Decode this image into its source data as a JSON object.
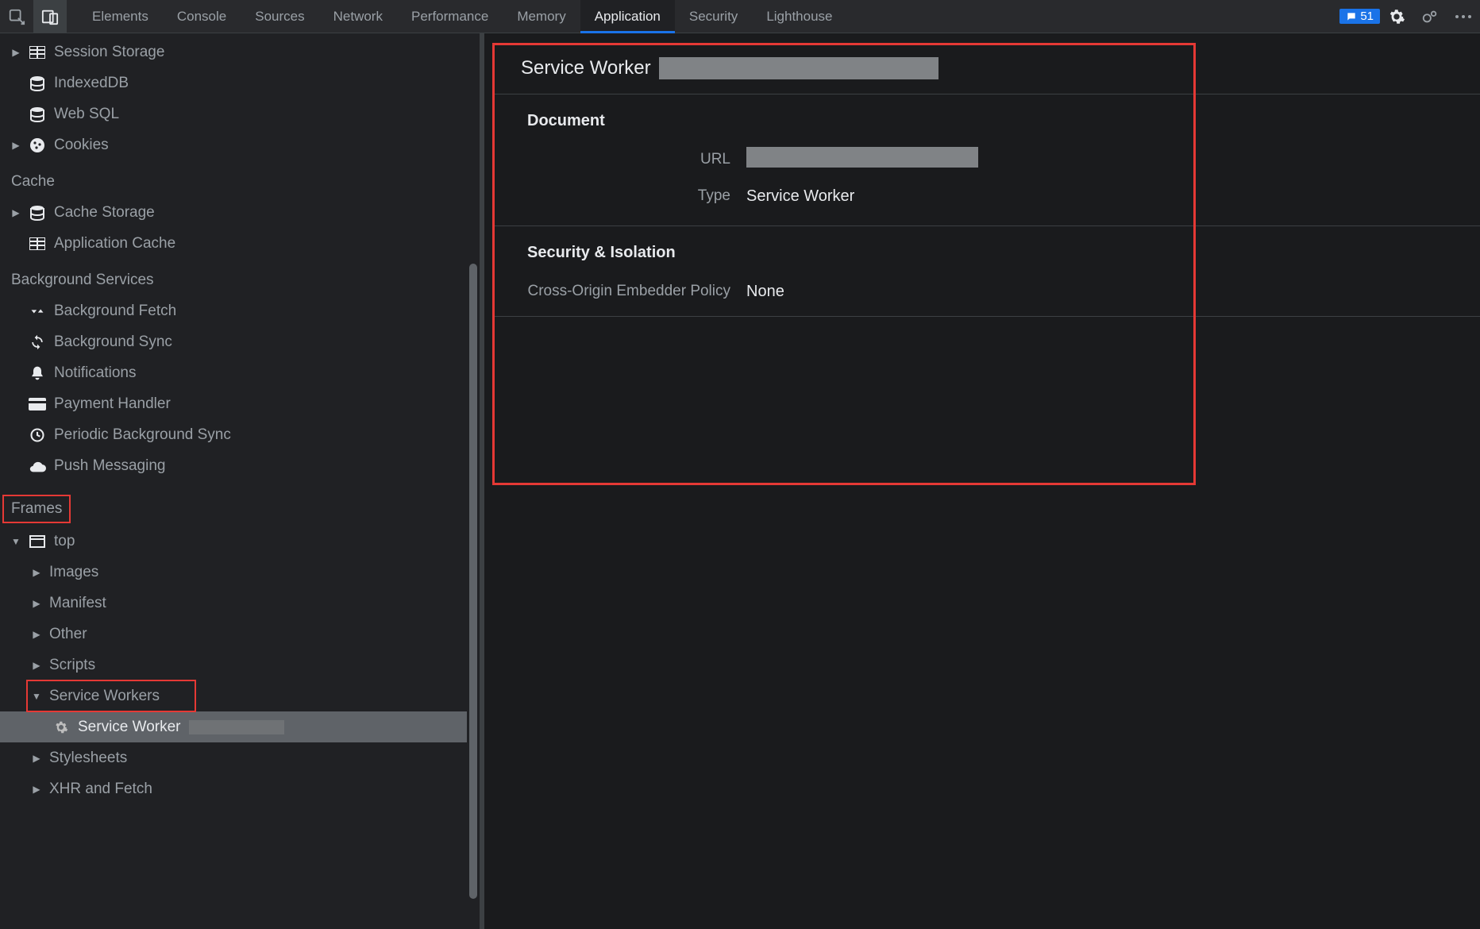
{
  "topbar": {
    "tabs": [
      "Elements",
      "Console",
      "Sources",
      "Network",
      "Performance",
      "Memory",
      "Application",
      "Security",
      "Lighthouse"
    ],
    "active_tab": "Application",
    "issue_count": "51"
  },
  "sidebar": {
    "storage": {
      "items": [
        {
          "label": "Session Storage",
          "icon": "table",
          "expandable": true
        },
        {
          "label": "IndexedDB",
          "icon": "database",
          "expandable": false
        },
        {
          "label": "Web SQL",
          "icon": "database",
          "expandable": false
        },
        {
          "label": "Cookies",
          "icon": "cookie",
          "expandable": true
        }
      ]
    },
    "cache": {
      "heading": "Cache",
      "items": [
        {
          "label": "Cache Storage",
          "icon": "database",
          "expandable": true
        },
        {
          "label": "Application Cache",
          "icon": "table",
          "expandable": false
        }
      ]
    },
    "bgservices": {
      "heading": "Background Services",
      "items": [
        {
          "label": "Background Fetch",
          "icon": "fetch"
        },
        {
          "label": "Background Sync",
          "icon": "sync"
        },
        {
          "label": "Notifications",
          "icon": "bell"
        },
        {
          "label": "Payment Handler",
          "icon": "card"
        },
        {
          "label": "Periodic Background Sync",
          "icon": "clock"
        },
        {
          "label": "Push Messaging",
          "icon": "cloud"
        }
      ]
    },
    "frames": {
      "heading": "Frames",
      "top_label": "top",
      "children": [
        "Images",
        "Manifest",
        "Other",
        "Scripts"
      ],
      "sw_group": "Service Workers",
      "sw_item": "Service Worker",
      "tail": [
        "Stylesheets",
        "XHR and Fetch"
      ]
    }
  },
  "panel": {
    "title": "Service Worker",
    "sections": {
      "document": {
        "heading": "Document",
        "url_label": "URL",
        "url_value": "",
        "type_label": "Type",
        "type_value": "Service Worker"
      },
      "security": {
        "heading": "Security & Isolation",
        "coep_label": "Cross-Origin Embedder Policy",
        "coep_value": "None"
      }
    }
  }
}
